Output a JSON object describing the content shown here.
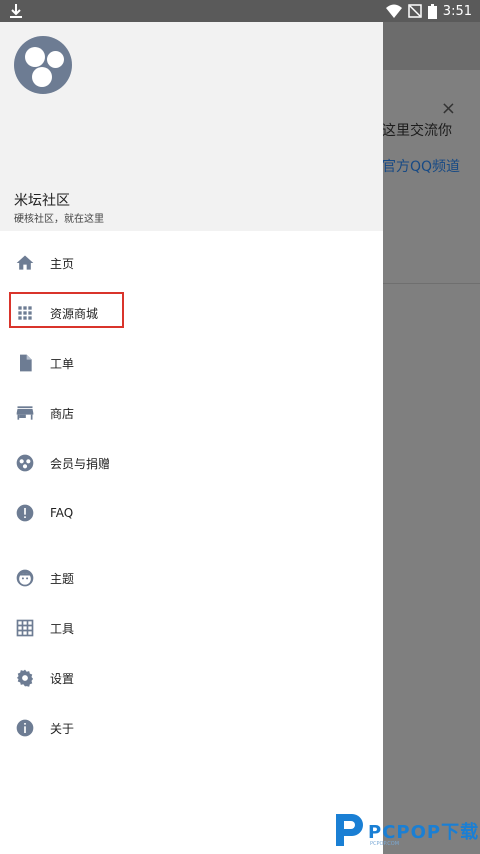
{
  "status_bar": {
    "time": "3:51"
  },
  "background": {
    "snippet_line1": "这里交流你",
    "snippet_line2": "官方QQ频道",
    "close_glyph": "×"
  },
  "drawer": {
    "app_name": "米坛社区",
    "slogan": "硬核社区，就在这里",
    "menu_items": [
      {
        "label": "主页",
        "icon": "home-icon"
      },
      {
        "label": "资源商城",
        "icon": "grid-icon"
      },
      {
        "label": "工单",
        "icon": "document-icon"
      },
      {
        "label": "商店",
        "icon": "store-icon"
      },
      {
        "label": "会员与捐赠",
        "icon": "donate-icon"
      },
      {
        "label": "FAQ",
        "icon": "info-alert-icon"
      }
    ],
    "menu_items_2": [
      {
        "label": "主题",
        "icon": "face-icon"
      },
      {
        "label": "工具",
        "icon": "table-grid-icon"
      },
      {
        "label": "设置",
        "icon": "gear-icon"
      },
      {
        "label": "关于",
        "icon": "info-icon"
      }
    ],
    "icon_color": "#6d7c93",
    "highlight_color": "#d9342b"
  },
  "watermark": {
    "text": "PCPOP下载",
    "sub": "PCPOP.COM"
  }
}
